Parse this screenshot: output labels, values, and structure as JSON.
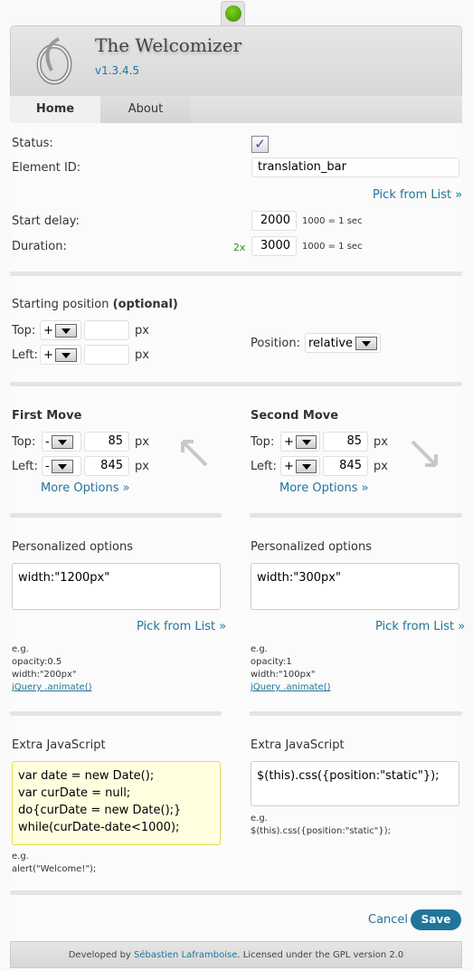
{
  "header": {
    "title": "The Welcomizer",
    "version": "v1.3.4.5"
  },
  "tabs": [
    {
      "label": "Home"
    },
    {
      "label": "About"
    }
  ],
  "general": {
    "status_label": "Status:",
    "status_checked": true,
    "check_mark": "✓",
    "element_id_label": "Element ID:",
    "element_id_value": "translation_bar",
    "pick_from_list": "Pick from List »",
    "start_delay_label": "Start delay:",
    "start_delay_value": "2000",
    "unit_hint": "1000 = 1 sec",
    "duration_label": "Duration:",
    "duration_multiplier": "2x",
    "duration_value": "3000"
  },
  "starting": {
    "title": "Starting position",
    "optional": "(optional)",
    "top_label": "Top:",
    "left_label": "Left:",
    "top_sign": "+",
    "left_sign": "+",
    "top_value": "",
    "left_value": "",
    "px": "px",
    "position_label": "Position:",
    "position_value": "relative"
  },
  "first_move": {
    "title": "First Move",
    "top_label": "Top:",
    "left_label": "Left:",
    "top_sign": "-",
    "left_sign": "-",
    "top_value": "85",
    "left_value": "845",
    "px": "px",
    "more": "More Options »"
  },
  "second_move": {
    "title": "Second Move",
    "top_label": "Top:",
    "left_label": "Left:",
    "top_sign": "+",
    "left_sign": "+",
    "top_value": "85",
    "left_value": "845",
    "px": "px",
    "more": "More Options »"
  },
  "personalized": [
    {
      "title": "Personalized options",
      "value": "width:\"1200px\"",
      "pick": "Pick from List »",
      "eg": "e.g.",
      "ex1": "opacity:0.5",
      "ex2": "width:\"200px\"",
      "link": "jQuery .animate()"
    },
    {
      "title": "Personalized options",
      "value": "width:\"300px\"",
      "pick": "Pick from List »",
      "eg": "e.g.",
      "ex1": "opacity:1",
      "ex2": "width:\"100px\"",
      "link": "jQuery .animate()"
    }
  ],
  "extra_js": [
    {
      "title": "Extra JavaScript",
      "lines": [
        "var date = new Date();",
        "var curDate = null;",
        "do{curDate = new Date();}",
        "while(curDate-date<1000);"
      ],
      "eg": "e.g.",
      "example": "alert(\"Welcome!\");"
    },
    {
      "title": "Extra JavaScript",
      "lines": [
        "$(this).css({position:\"static\"});"
      ],
      "eg": "e.g.",
      "example": "$(this).css({position:\"static\"});"
    }
  ],
  "actions": {
    "cancel": "Cancel",
    "save": "Save"
  },
  "footer": {
    "prefix": "Developed by ",
    "author": "Sébastien Laframboise",
    "suffix": ". Licensed under the GPL version 2.0"
  }
}
